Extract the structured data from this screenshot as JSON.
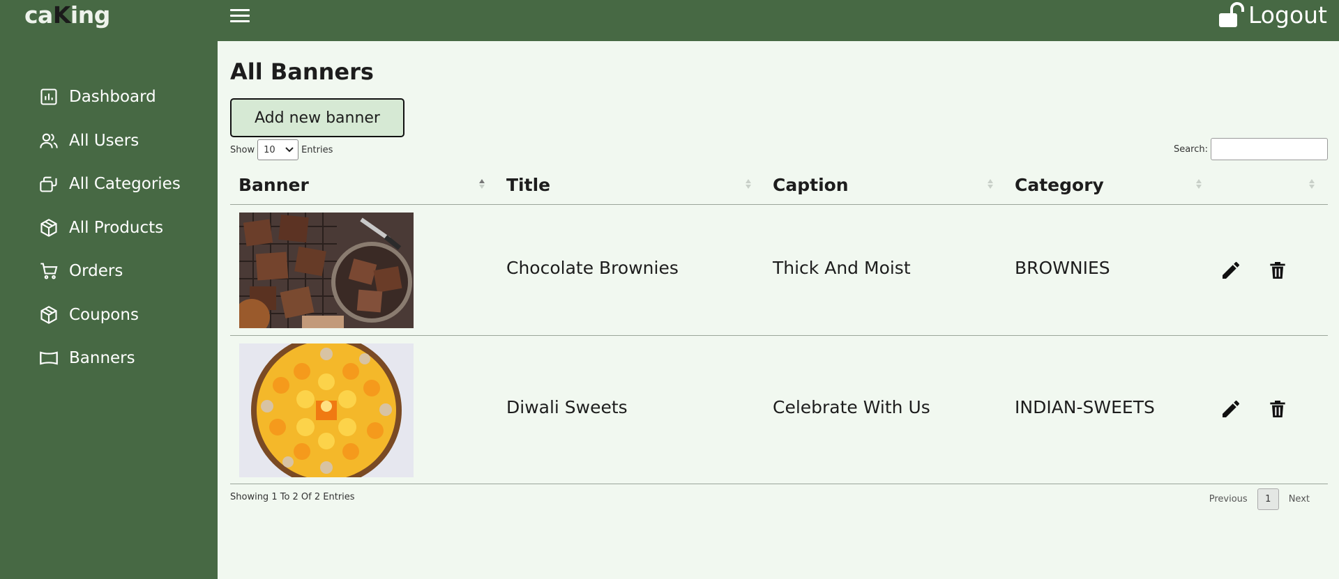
{
  "brand": {
    "part1": "ca",
    "part2": "K",
    "part3": "ing"
  },
  "sidebar": {
    "items": [
      {
        "label": "Dashboard",
        "icon": "chart-bar-icon"
      },
      {
        "label": "All Users",
        "icon": "users-icon"
      },
      {
        "label": "All Categories",
        "icon": "categories-icon"
      },
      {
        "label": "All Products",
        "icon": "box-icon"
      },
      {
        "label": "Orders",
        "icon": "cart-icon"
      },
      {
        "label": "Coupons",
        "icon": "box-icon"
      },
      {
        "label": "Banners",
        "icon": "banner-icon"
      }
    ]
  },
  "topbar": {
    "logout_label": "Logout"
  },
  "page": {
    "title": "All Banners",
    "add_button": "Add new banner",
    "show_label": "Show",
    "entries_label": "Entries",
    "page_length": "10",
    "search_label": "Search:",
    "search_value": ""
  },
  "table": {
    "columns": [
      "Banner",
      "Title",
      "Caption",
      "Category",
      ""
    ],
    "rows": [
      {
        "title": "Chocolate Brownies",
        "caption": "Thick And Moist",
        "category": "BROWNIES",
        "image": "brownies photo"
      },
      {
        "title": "Diwali Sweets",
        "caption": "Celebrate With Us",
        "category": "INDIAN-SWEETS",
        "image": "indian sweets platter photo"
      }
    ]
  },
  "footer": {
    "info": "Showing 1 To 2 Of 2 Entries",
    "previous": "Previous",
    "current_page": "1",
    "next": "Next"
  },
  "colors": {
    "sidebar": "#476944",
    "background": "#f1f8f0",
    "button": "#d6e9d4"
  }
}
